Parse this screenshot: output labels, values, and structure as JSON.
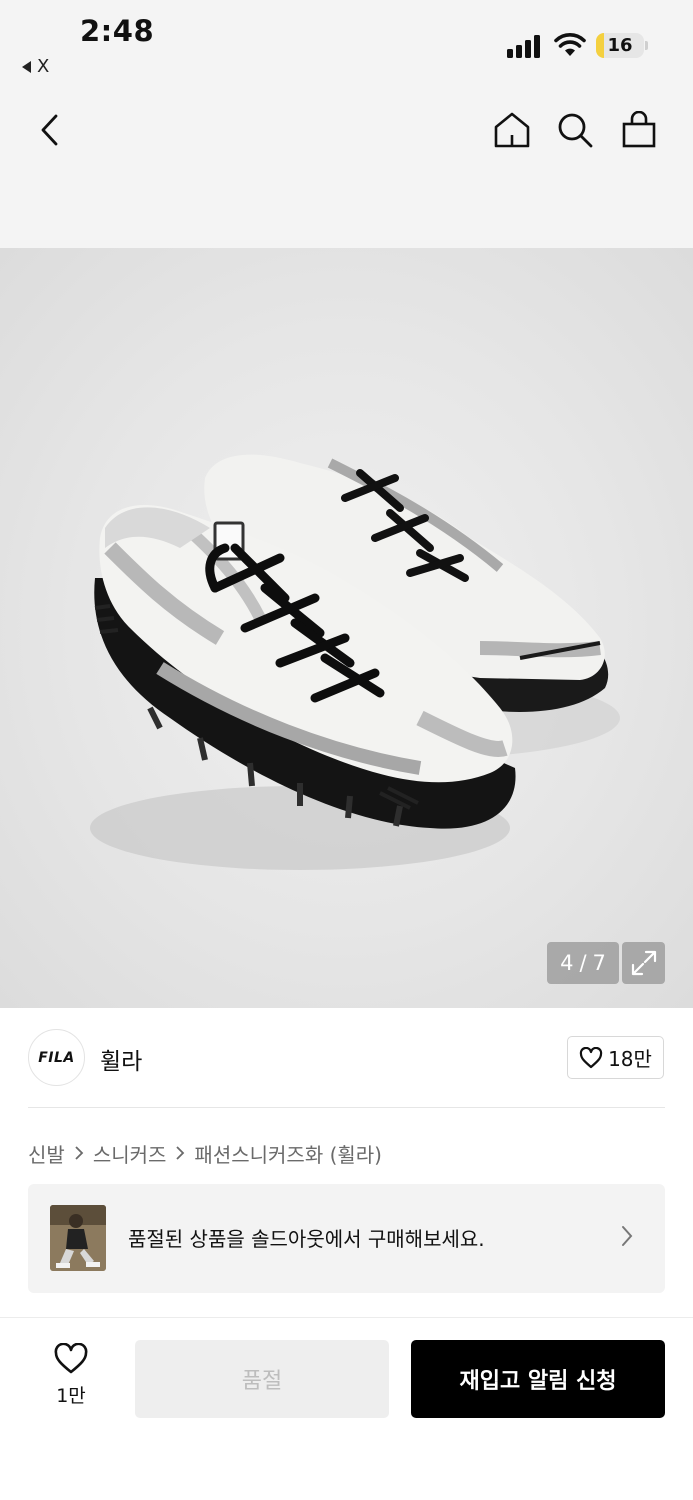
{
  "status_bar": {
    "time": "2:48",
    "back_app_label": "X",
    "battery_level": "16"
  },
  "nav": {
    "back_icon": "chevron-left-icon",
    "home_icon": "home-icon",
    "search_icon": "search-icon",
    "cart_icon": "shopping-bag-icon"
  },
  "gallery": {
    "current": "4",
    "separator": "/",
    "total": "7",
    "expand_icon": "expand-icon"
  },
  "brand": {
    "logo_text": "FILA",
    "name": "휠라",
    "like_count": "18만"
  },
  "breadcrumb": [
    "신발",
    "스니커즈",
    "패션스니커즈화 (휠라)"
  ],
  "soldout_banner": {
    "text": "품절된 상품을 솔드아웃에서 구매해보세요."
  },
  "bottom_bar": {
    "wish_count": "1만",
    "soldout_label": "품절",
    "restock_label": "재입고 알림 신청"
  },
  "colors": {
    "accent": "#000000",
    "battery": "#f4d03f",
    "background_gray": "#f4f4f4"
  }
}
